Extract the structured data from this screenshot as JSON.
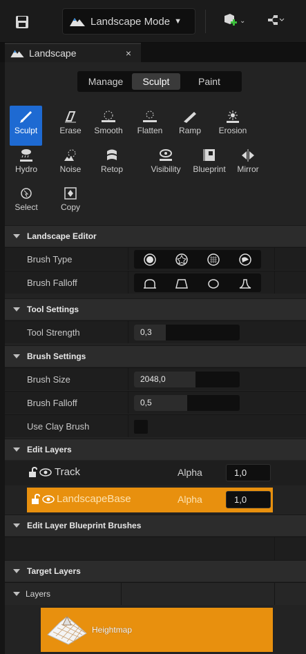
{
  "toolbar": {
    "save_icon": "save-icon",
    "mode_dropdown": {
      "label": "Landscape Mode",
      "icon": "landscape-icon"
    },
    "icons": [
      "add-actor-icon",
      "blueprint-graph-icon"
    ]
  },
  "tab": {
    "label": "Landscape",
    "close": "×"
  },
  "modes": [
    "Manage",
    "Sculpt",
    "Paint"
  ],
  "active_mode": "Sculpt",
  "tools": [
    {
      "label": "Sculpt",
      "icon": "sculpt-brush-icon",
      "active": true
    },
    {
      "label": "Erase",
      "icon": "erase-icon"
    },
    {
      "label": "Smooth",
      "icon": "smooth-icon"
    },
    {
      "label": "Flatten",
      "icon": "flatten-icon"
    },
    {
      "label": "Ramp",
      "icon": "ramp-icon"
    },
    {
      "label": "Erosion",
      "icon": "erosion-icon"
    },
    {
      "label": "Hydro",
      "icon": "hydro-icon"
    },
    {
      "label": "Noise",
      "icon": "noise-icon"
    },
    {
      "label": "Retop",
      "icon": "retopologize-icon"
    },
    {
      "label": "Visibility",
      "icon": "visibility-icon"
    },
    {
      "label": "Blueprint",
      "icon": "blueprint-icon"
    },
    {
      "label": "Mirror",
      "icon": "mirror-icon"
    },
    {
      "label": "Select",
      "icon": "select-icon"
    },
    {
      "label": "Copy",
      "icon": "copy-icon"
    }
  ],
  "sections": {
    "landscape_editor": "Landscape Editor",
    "tool_settings": "Tool Settings",
    "brush_settings": "Brush Settings",
    "edit_layers": "Edit Layers",
    "edit_layer_bp_brushes": "Edit Layer Blueprint Brushes",
    "target_layers": "Target Layers",
    "layers": "Layers"
  },
  "brush_type": {
    "label": "Brush Type",
    "options": [
      "circle-brush-icon",
      "alpha-brush-icon",
      "pattern-brush-icon",
      "component-brush-icon"
    ],
    "selected": "circle-brush-icon"
  },
  "brush_falloff_shape": {
    "label": "Brush Falloff",
    "options": [
      "smooth-falloff-icon",
      "linear-falloff-icon",
      "spherical-falloff-icon",
      "tip-falloff-icon"
    ],
    "selected": "smooth-falloff-icon"
  },
  "tool_strength": {
    "label": "Tool Strength",
    "value": "0,3",
    "fraction": 0.3
  },
  "brush_size": {
    "label": "Brush Size",
    "value": "2048,0",
    "fraction": 0.58
  },
  "brush_falloff": {
    "label": "Brush Falloff",
    "value": "0,5",
    "fraction": 0.5
  },
  "use_clay_brush": {
    "label": "Use Clay Brush",
    "checked": false
  },
  "edit_layers": [
    {
      "name": "Track",
      "alpha_label": "Alpha",
      "alpha": "1,0",
      "active": false
    },
    {
      "name": "LandscapeBase",
      "alpha_label": "Alpha",
      "alpha": "1,0",
      "active": true
    }
  ],
  "heightmap": {
    "label": "Heightmap"
  },
  "colors": {
    "accent_orange": "#e8900e",
    "accent_blue": "#1e6ad2"
  }
}
